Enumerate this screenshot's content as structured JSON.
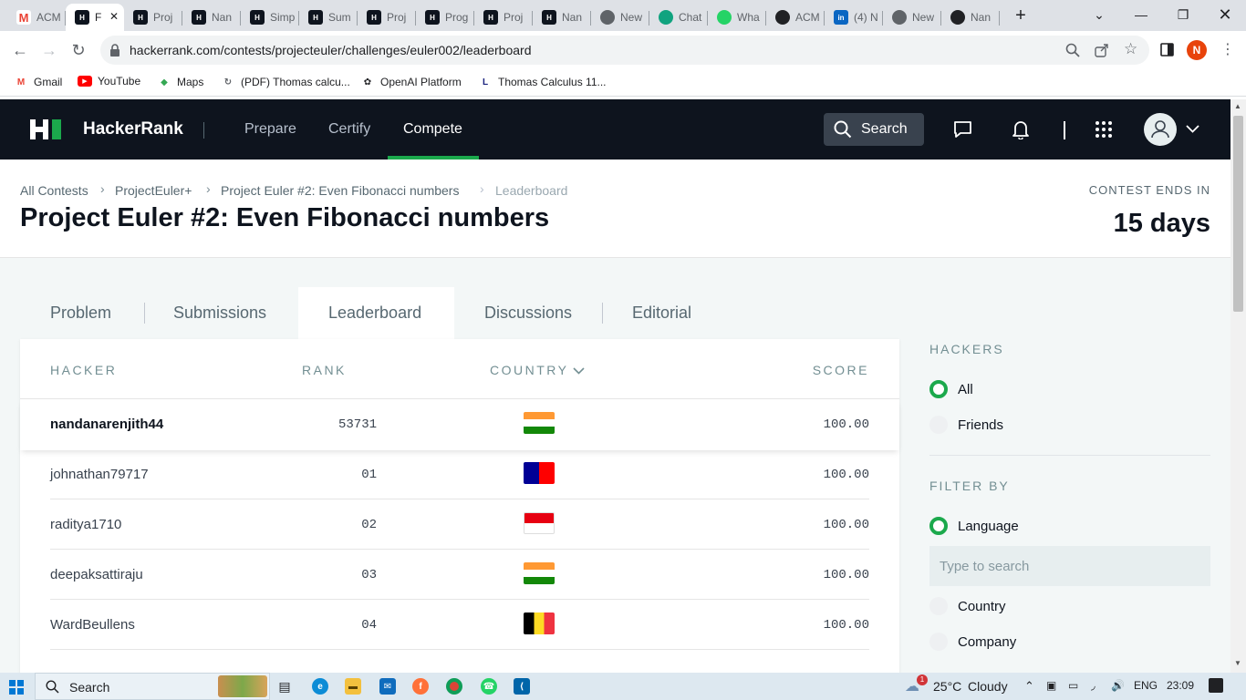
{
  "browser": {
    "tabs": [
      {
        "label": "ACM",
        "icon": "gmail-icon",
        "color": "#ea4335"
      },
      {
        "label": "F",
        "icon": "hackerrank-icon",
        "active": true
      },
      {
        "label": "Proj",
        "icon": "hackerrank-icon"
      },
      {
        "label": "Nan",
        "icon": "hackerrank-icon"
      },
      {
        "label": "Simp",
        "icon": "hackerrank-icon"
      },
      {
        "label": "Sum",
        "icon": "hackerrank-icon"
      },
      {
        "label": "Proj",
        "icon": "hackerrank-icon"
      },
      {
        "label": "Prog",
        "icon": "hackerrank-icon"
      },
      {
        "label": "Proj",
        "icon": "hackerrank-icon"
      },
      {
        "label": "Nan",
        "icon": "hackerrank-icon"
      },
      {
        "label": "New",
        "icon": "chrome-icon"
      },
      {
        "label": "Chat",
        "icon": "openai-icon"
      },
      {
        "label": "Wha",
        "icon": "whatsapp-icon"
      },
      {
        "label": "ACM",
        "icon": "github-icon"
      },
      {
        "label": "(4) N",
        "icon": "linkedin-icon"
      },
      {
        "label": "New",
        "icon": "chrome-icon"
      },
      {
        "label": "Nan",
        "icon": "github-icon"
      }
    ],
    "url": "hackerrank.com/contests/projecteuler/challenges/euler002/leaderboard",
    "profile_initial": "N",
    "bookmarks": [
      {
        "label": "Gmail",
        "icon": "gmail-icon"
      },
      {
        "label": "YouTube",
        "icon": "youtube-icon"
      },
      {
        "label": "Maps",
        "icon": "maps-icon"
      },
      {
        "label": "(PDF) Thomas calcu...",
        "icon": "researchgate-icon"
      },
      {
        "label": "OpenAI Platform",
        "icon": "openai-icon"
      },
      {
        "label": "Thomas Calculus 11...",
        "icon": "lms-icon"
      }
    ]
  },
  "hackerrank": {
    "brand": "HackerRank",
    "nav": {
      "prepare": "Prepare",
      "certify": "Certify",
      "compete": "Compete"
    },
    "search_label": "Search"
  },
  "page": {
    "breadcrumbs": [
      "All Contests",
      "ProjectEuler+",
      "Project Euler #2: Even Fibonacci numbers",
      "Leaderboard"
    ],
    "title": "Project Euler #2: Even Fibonacci numbers",
    "contest_ends_label": "CONTEST ENDS IN",
    "contest_ends_value": "15 days",
    "tabs": [
      "Problem",
      "Submissions",
      "Leaderboard",
      "Discussions",
      "Editorial"
    ]
  },
  "leaderboard": {
    "headers": {
      "hacker": "HACKER",
      "rank": "RANK",
      "country": "COUNTRY",
      "score": "SCORE"
    },
    "rows": [
      {
        "hacker": "nandanarenjith44",
        "rank": "53731",
        "flag": "india-flag",
        "score": "100.00",
        "self": true
      },
      {
        "hacker": "johnathan79717",
        "rank": "01",
        "flag": "taiwan-flag",
        "score": "100.00"
      },
      {
        "hacker": "raditya1710",
        "rank": "02",
        "flag": "indonesia-flag",
        "score": "100.00"
      },
      {
        "hacker": "deepaksattiraju",
        "rank": "03",
        "flag": "india-flag",
        "score": "100.00"
      },
      {
        "hacker": "WardBeullens",
        "rank": "04",
        "flag": "belgium-flag",
        "score": "100.00"
      }
    ]
  },
  "sidebar": {
    "hackers_heading": "HACKERS",
    "all_label": "All",
    "friends_label": "Friends",
    "filter_heading": "FILTER BY",
    "language_label": "Language",
    "search_placeholder": "Type to search",
    "country_label": "Country",
    "company_label": "Company"
  },
  "taskbar": {
    "search_label": "Search",
    "weather_temp": "25°C",
    "weather_text": "Cloudy",
    "weather_badge": "1",
    "lang": "ENG",
    "time": "23:09"
  },
  "colors": {
    "accent": "#1ba94c",
    "nav_bg": "#0e141e"
  }
}
